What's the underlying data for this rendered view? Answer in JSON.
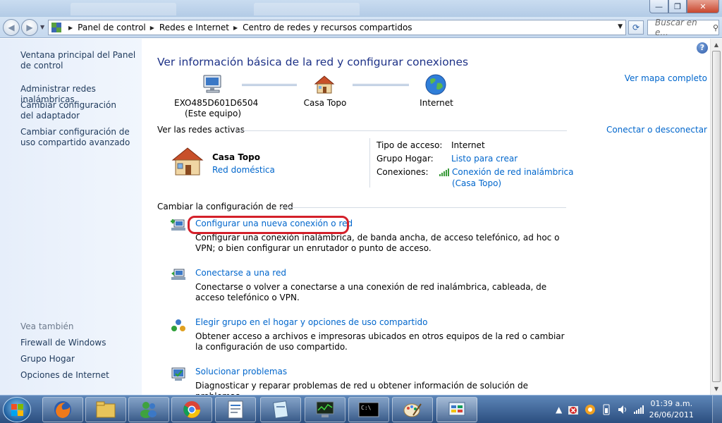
{
  "window": {
    "min_glyph": "—",
    "max_glyph": "❐",
    "close_glyph": "✕"
  },
  "address": {
    "crumbs": [
      "Panel de control",
      "Redes e Internet",
      "Centro de redes y recursos compartidos"
    ],
    "search_placeholder": "Buscar en e..."
  },
  "sidebar": {
    "items": [
      "Ventana principal del Panel de control",
      "Administrar redes inalámbricas",
      "Cambiar configuración del adaptador",
      "Cambiar configuración de uso compartido avanzado"
    ],
    "see_also_header": "Vea también",
    "see_also": [
      "Firewall de Windows",
      "Grupo Hogar",
      "Opciones de Internet"
    ]
  },
  "main": {
    "title": "Ver información básica de la red y configurar conexiones",
    "full_map_link": "Ver mapa completo",
    "map": {
      "computer_name": "EXO485D601D6504",
      "computer_sub": "(Este equipo)",
      "network_name": "Casa Topo",
      "internet": "Internet"
    },
    "active_networks": {
      "header": "Ver las redes activas",
      "connect_link": "Conectar o desconectar",
      "network_name": "Casa Topo",
      "network_type": "Red doméstica",
      "access_type_label": "Tipo de acceso:",
      "access_type_value": "Internet",
      "homegroup_label": "Grupo Hogar:",
      "homegroup_value": "Listo para crear",
      "connections_label": "Conexiones:",
      "connection_value_1": "Conexión de red inalámbrica",
      "connection_value_2": "(Casa Topo)"
    },
    "change_settings": {
      "header": "Cambiar la configuración de red",
      "tasks": [
        {
          "link": "Configurar una nueva conexión o red",
          "desc": "Configurar una conexión inalámbrica, de banda ancha, de acceso telefónico, ad hoc o VPN; o bien configurar un enrutador o punto de acceso."
        },
        {
          "link": "Conectarse a una red",
          "desc": "Conectarse o volver a conectarse a una conexión de red inalámbrica, cableada, de acceso telefónico o VPN."
        },
        {
          "link": "Elegir grupo en el hogar y opciones de uso compartido",
          "desc": "Obtener acceso a archivos e impresoras ubicados en otros equipos de la red o cambiar la configuración de uso compartido."
        },
        {
          "link": "Solucionar problemas",
          "desc": "Diagnosticar y reparar problemas de red u obtener información de solución de problemas."
        }
      ]
    }
  },
  "taskbar": {
    "clock_time": "01:39 a.m.",
    "clock_date": "26/06/2011",
    "tray_arrow": "▲"
  },
  "colors": {
    "link": "#0066cc",
    "title": "#1e3287",
    "highlight": "#d4202a"
  }
}
